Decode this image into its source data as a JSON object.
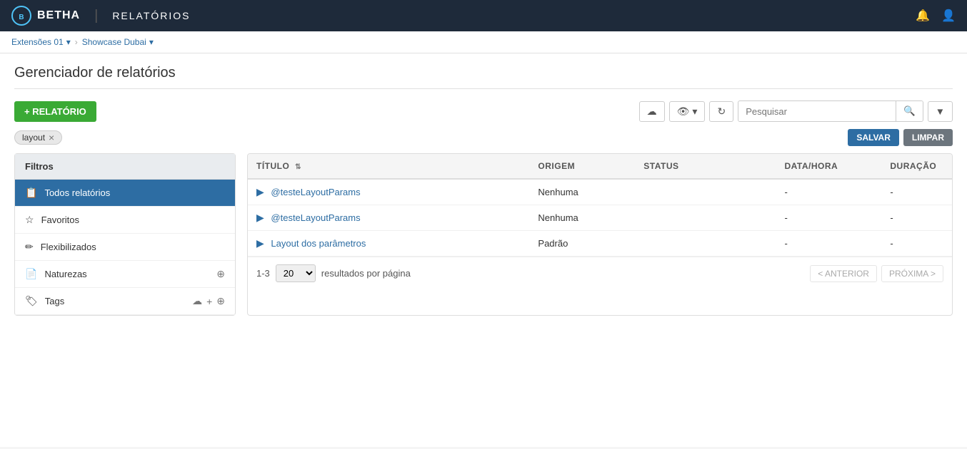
{
  "app": {
    "logo_text": "BETHA",
    "module_title": "RELATÓRIOS"
  },
  "breadcrumb": {
    "items": [
      {
        "label": "Extensões 01",
        "has_dropdown": true
      },
      {
        "label": "Showcase Dubai",
        "has_dropdown": true
      }
    ]
  },
  "page": {
    "title": "Gerenciador de relatórios"
  },
  "toolbar": {
    "add_button_label": "+ RELATÓRIO",
    "search_placeholder": "Pesquisar",
    "upload_icon": "☁",
    "eye_icon": "👁",
    "refresh_icon": "↻",
    "search_icon": "🔍",
    "filter_icon": "▼"
  },
  "filter_tags": {
    "tags": [
      {
        "label": "layout"
      }
    ],
    "save_label": "SALVAR",
    "clear_label": "LIMPAR"
  },
  "sidebar": {
    "header": "Filtros",
    "items": [
      {
        "label": "Todos relatórios",
        "icon": "📋",
        "active": true
      },
      {
        "label": "Favoritos",
        "icon": "☆",
        "active": false
      },
      {
        "label": "Flexibilizados",
        "icon": "✏",
        "active": false
      },
      {
        "label": "Naturezas",
        "icon": "📄",
        "active": false,
        "has_actions": true
      },
      {
        "label": "Tags",
        "icon": "🏷",
        "active": false,
        "has_actions": true
      }
    ]
  },
  "table": {
    "columns": [
      {
        "key": "titulo",
        "label": "TÍTULO",
        "sortable": true
      },
      {
        "key": "origem",
        "label": "ORIGEM"
      },
      {
        "key": "status",
        "label": "STATUS"
      },
      {
        "key": "datahora",
        "label": "DATA/HORA"
      },
      {
        "key": "duracao",
        "label": "DURAÇÃO"
      }
    ],
    "rows": [
      {
        "titulo": "@testeLayoutParams",
        "origem": "Nenhuma",
        "status": "",
        "datahora": "-",
        "duracao": "-"
      },
      {
        "titulo": "@testeLayoutParams",
        "origem": "Nenhuma",
        "status": "",
        "datahora": "-",
        "duracao": "-"
      },
      {
        "titulo": "Layout dos parâmetros",
        "origem": "Padrão",
        "status": "",
        "datahora": "-",
        "duracao": "-"
      }
    ]
  },
  "pagination": {
    "range": "1-3",
    "per_page": "20",
    "results_label": "resultados por página",
    "prev_label": "< ANTERIOR",
    "next_label": "PRÓXIMA >"
  }
}
